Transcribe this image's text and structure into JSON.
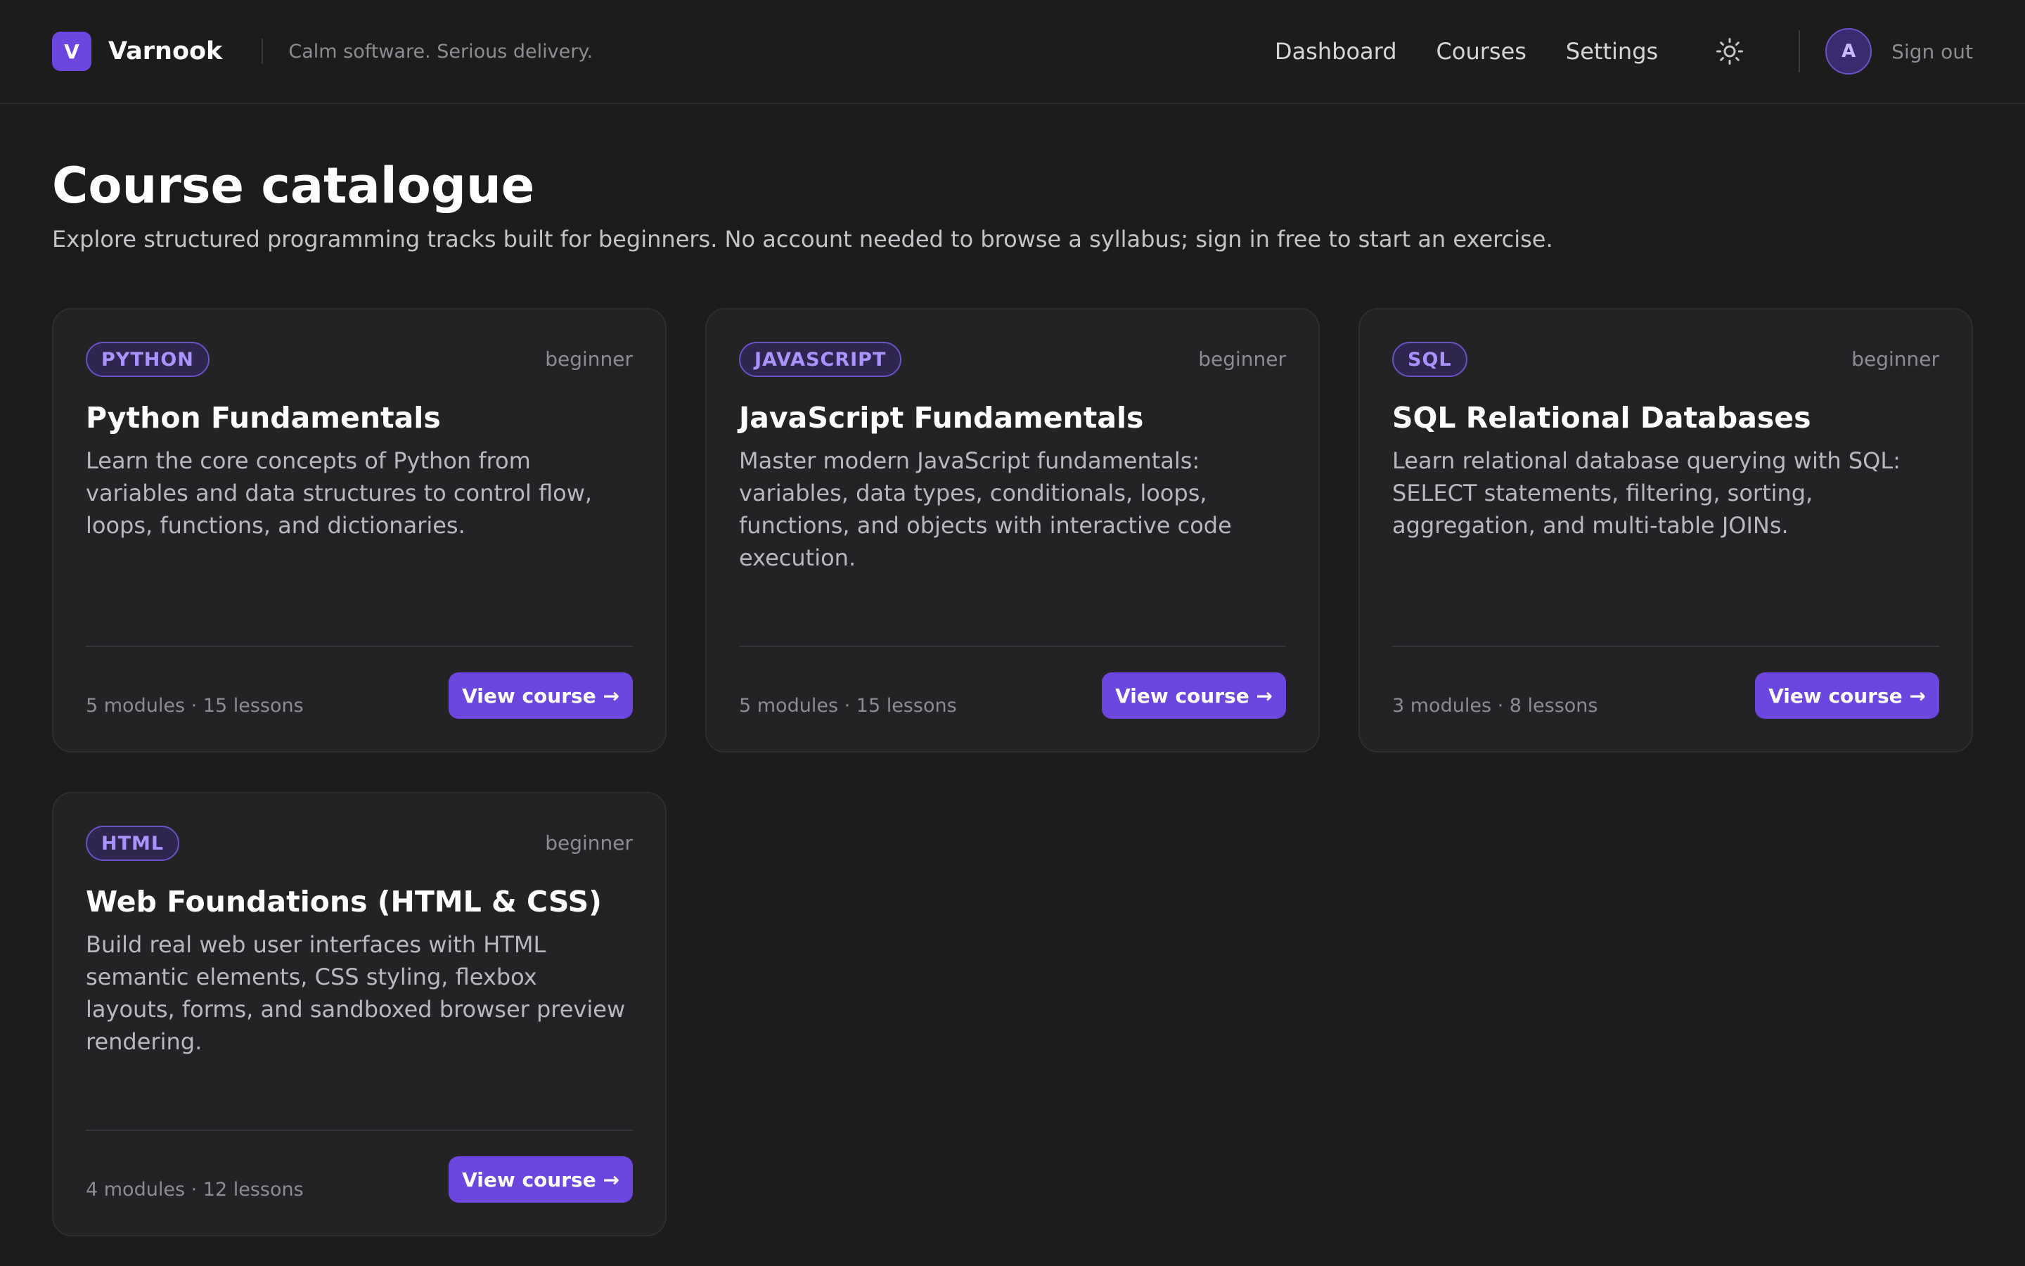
{
  "header": {
    "logo_letter": "V",
    "brand": "Varnook",
    "tagline": "Calm software. Serious delivery.",
    "nav": [
      {
        "label": "Dashboard"
      },
      {
        "label": "Courses"
      },
      {
        "label": "Settings"
      }
    ],
    "avatar_initial": "A",
    "signout_label": "Sign out"
  },
  "page": {
    "title": "Course catalogue",
    "subtitle": "Explore structured programming tracks built for beginners. No account needed to browse a syllabus; sign in free to start an exercise."
  },
  "courses": [
    {
      "tag": "PYTHON",
      "level": "beginner",
      "title": "Python Fundamentals",
      "description": "Learn the core concepts of Python from variables and data structures to control flow, loops, functions, and dictionaries.",
      "meta": "5 modules · 15 lessons",
      "button": "View course →"
    },
    {
      "tag": "JAVASCRIPT",
      "level": "beginner",
      "title": "JavaScript Fundamentals",
      "description": "Master modern JavaScript fundamentals: variables, data types, conditionals, loops, functions, and objects with interactive code execution.",
      "meta": "5 modules · 15 lessons",
      "button": "View course →"
    },
    {
      "tag": "SQL",
      "level": "beginner",
      "title": "SQL Relational Databases",
      "description": "Learn relational database querying with SQL: SELECT statements, filtering, sorting, aggregation, and multi-table JOINs.",
      "meta": "3 modules · 8 lessons",
      "button": "View course →"
    },
    {
      "tag": "HTML",
      "level": "beginner",
      "title": "Web Foundations (HTML & CSS)",
      "description": "Build real web user interfaces with HTML semantic elements, CSS styling, flexbox layouts, forms, and sandboxed browser preview rendering.",
      "meta": "4 modules · 12 lessons",
      "button": "View course →"
    }
  ],
  "colors": {
    "accent": "#6d46e0",
    "background": "#1c1c1d",
    "card": "#232325"
  }
}
